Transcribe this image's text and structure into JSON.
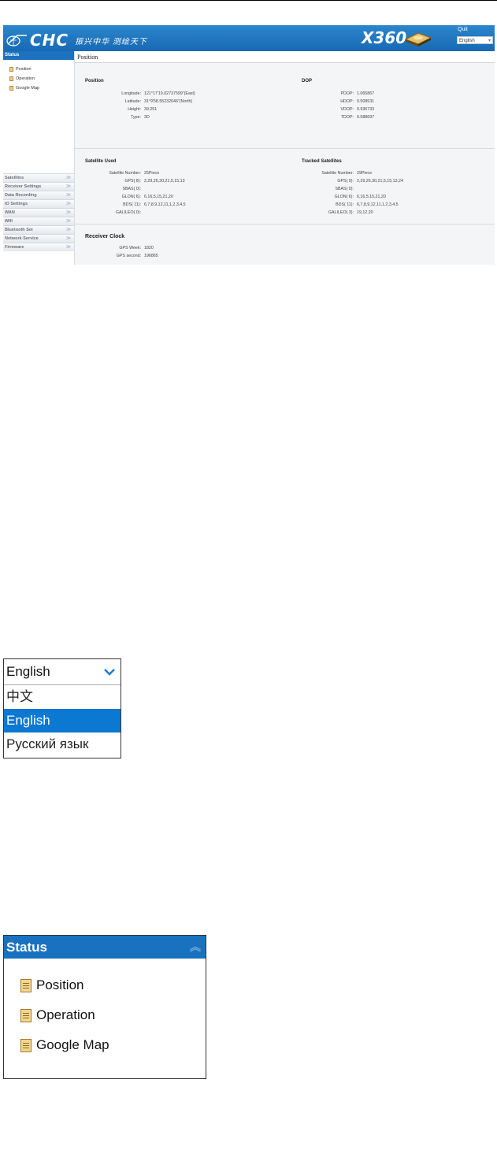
{
  "header": {
    "brand": "CHC",
    "slogan": "振兴中华  测绘天下",
    "model": "X360",
    "quit_label": "Quit",
    "language_value": "English"
  },
  "sidebar": {
    "status_title": "Status",
    "links": [
      "Position",
      "Operation",
      "Google Map"
    ],
    "sections": [
      "Satellites",
      "Receiver Settings",
      "Data Recording",
      "IO Settings",
      "WAN",
      "Wifi",
      "Bluetooth Set",
      "Network Service",
      "Firmware"
    ]
  },
  "content": {
    "title": "Position",
    "position": {
      "heading": "Position",
      "rows": [
        {
          "label": "Longitude:",
          "value": "121°17'19.02737599\"(East)"
        },
        {
          "label": "Latitude:",
          "value": "31°9'58.55232646\"(North)"
        },
        {
          "label": "Height:",
          "value": "39.251"
        },
        {
          "label": "Type:",
          "value": "3D"
        }
      ]
    },
    "dop": {
      "heading": "DOP",
      "rows": [
        {
          "label": "PDOP:",
          "value": "1.065867"
        },
        {
          "label": "HDOP:",
          "value": "0.508531"
        },
        {
          "label": "VDOP:",
          "value": "0.936733"
        },
        {
          "label": "TDOP:",
          "value": "0.588697"
        }
      ]
    },
    "satellite_used": {
      "heading": "Satellite Used",
      "rows": [
        {
          "label": "Satellite Number:",
          "value": "25Piece"
        },
        {
          "label": "GPS( 8):",
          "value": "2,29,26,30,21,5,15,13"
        },
        {
          "label": "SBAS( 0):",
          "value": ""
        },
        {
          "label": "GLON( 6):",
          "value": "6,16,5,15,21,20"
        },
        {
          "label": "BDS( 11):",
          "value": "6,7,8,9,12,11,1,2,3,4,5"
        },
        {
          "label": "GALILEO( 0):",
          "value": ""
        }
      ]
    },
    "tracked": {
      "heading": "Tracked Satellites",
      "rows": [
        {
          "label": "Satellite Number:",
          "value": "29Piece"
        },
        {
          "label": "GPS( 9):",
          "value": "2,29,26,30,21,5,15,13,24"
        },
        {
          "label": "SBAS( 0):",
          "value": ""
        },
        {
          "label": "GLON( 6):",
          "value": "6,16,5,15,21,20"
        },
        {
          "label": "BDS( 11):",
          "value": "6,7,8,9,12,11,1,2,3,4,5"
        },
        {
          "label": "GALILEO( 3):",
          "value": "19,12,20"
        }
      ]
    },
    "clock": {
      "heading": "Receiver Clock",
      "rows": [
        {
          "label": "GPS Week:",
          "value": "1820"
        },
        {
          "label": "GPS second:",
          "value": "196865"
        }
      ]
    }
  },
  "language_dropdown": {
    "selected": "English",
    "options": [
      "中文",
      "English",
      "Русский язык"
    ],
    "highlighted": "English"
  },
  "status_panel": {
    "title": "Status",
    "items": [
      "Position",
      "Operation",
      "Google Map"
    ]
  },
  "colors": {
    "banner_blue": "#1c72bf",
    "highlight_blue": "#0b78d1",
    "content_bg": "#f4f5f7"
  }
}
